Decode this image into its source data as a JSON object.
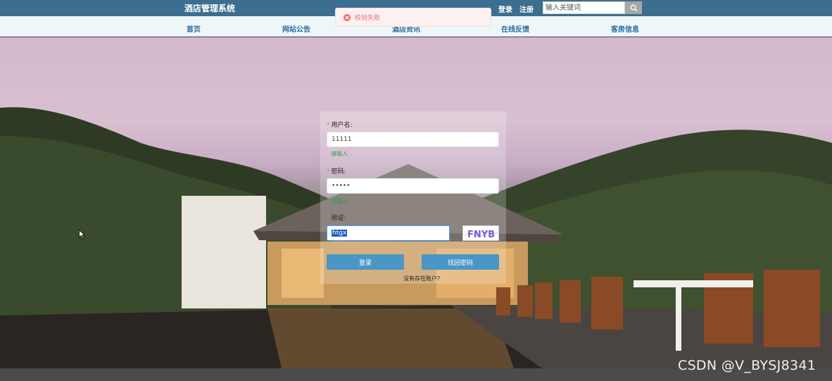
{
  "header": {
    "brand": "酒店管理系统",
    "login_label": "登录",
    "register_label": "注册",
    "search_placeholder": "输入关键词"
  },
  "nav": {
    "items": [
      {
        "label": "首页"
      },
      {
        "label": "网站公告"
      },
      {
        "label": "酒店资讯"
      },
      {
        "label": "在线反馈"
      },
      {
        "label": "客房信息"
      }
    ]
  },
  "toast": {
    "message": "校验失败",
    "color": "#f56c6c"
  },
  "form": {
    "username_label": "用户名:",
    "username_value": "11111",
    "username_hint": "请输入",
    "password_label": "密码:",
    "password_value": "•••••",
    "password_hint": "请输入",
    "captcha_label": "验证:",
    "captcha_value": "htgx",
    "captcha_image_text": "FNYB",
    "login_button": "登录",
    "forgot_button": "找回密码",
    "no_account_text": "没有存在账户?"
  },
  "watermark": "CSDN @V_BYSJ8341",
  "colors": {
    "topbar": "#3c6e8f",
    "navbar": "#eef6f7",
    "button": "#4a97c6",
    "hint": "#2e9e4e"
  }
}
